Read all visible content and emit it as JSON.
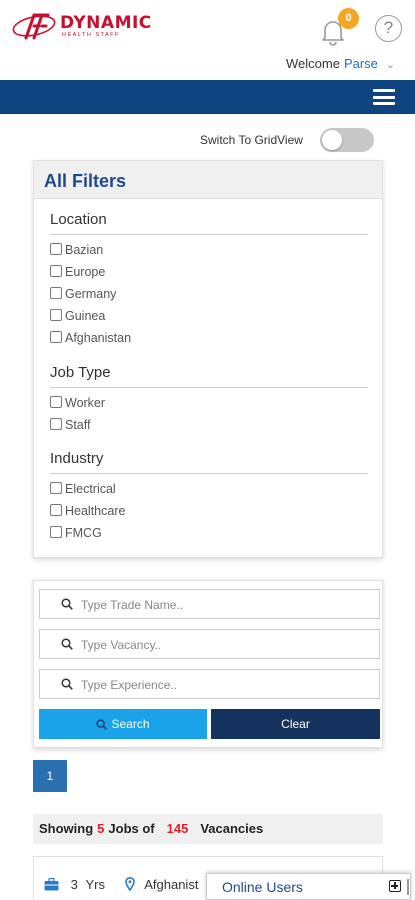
{
  "header": {
    "logo_text": "DYNAMIC",
    "logo_subtext": "HEALTH STAFF",
    "notification_count": "0",
    "help_glyph": "?",
    "welcome_label": "Welcome",
    "user_name": "Parse",
    "user_caret": "⌄",
    "brand_color": "#c8102e",
    "nav_color": "#0d4480"
  },
  "view_switch": {
    "label": "Switch To GridView",
    "enabled": false
  },
  "filters": {
    "title": "All Filters",
    "location": {
      "title": "Location",
      "options": [
        "Bazian",
        "Europe",
        "Germany",
        "Guinea",
        "Afghanistan"
      ]
    },
    "job_type": {
      "title": "Job Type",
      "options": [
        "Worker",
        "Staff"
      ]
    },
    "industry": {
      "title": "Industry",
      "options": [
        "Electrical",
        "Healthcare",
        "FMCG"
      ]
    }
  },
  "search": {
    "trade_placeholder": "Type Trade Name..",
    "vacancy_placeholder": "Type Vacancy..",
    "experience_placeholder": "Type Experience..",
    "search_label": "Search",
    "clear_label": "Clear",
    "search_color": "#1aa3e8",
    "clear_color": "#15325e"
  },
  "pagination": {
    "current_page": "1"
  },
  "results": {
    "showing_label": "Showing",
    "jobs_count": "5",
    "jobs_of_label": "Jobs of",
    "vacancies_count": "145",
    "vacancies_label": "Vacancies"
  },
  "job_card": {
    "experience_value": "3",
    "experience_unit": "Yrs",
    "location": "Afghanist",
    "icons": [
      "briefcase-icon",
      "location-pin-icon"
    ]
  },
  "online_users": {
    "title": "Online Users"
  }
}
